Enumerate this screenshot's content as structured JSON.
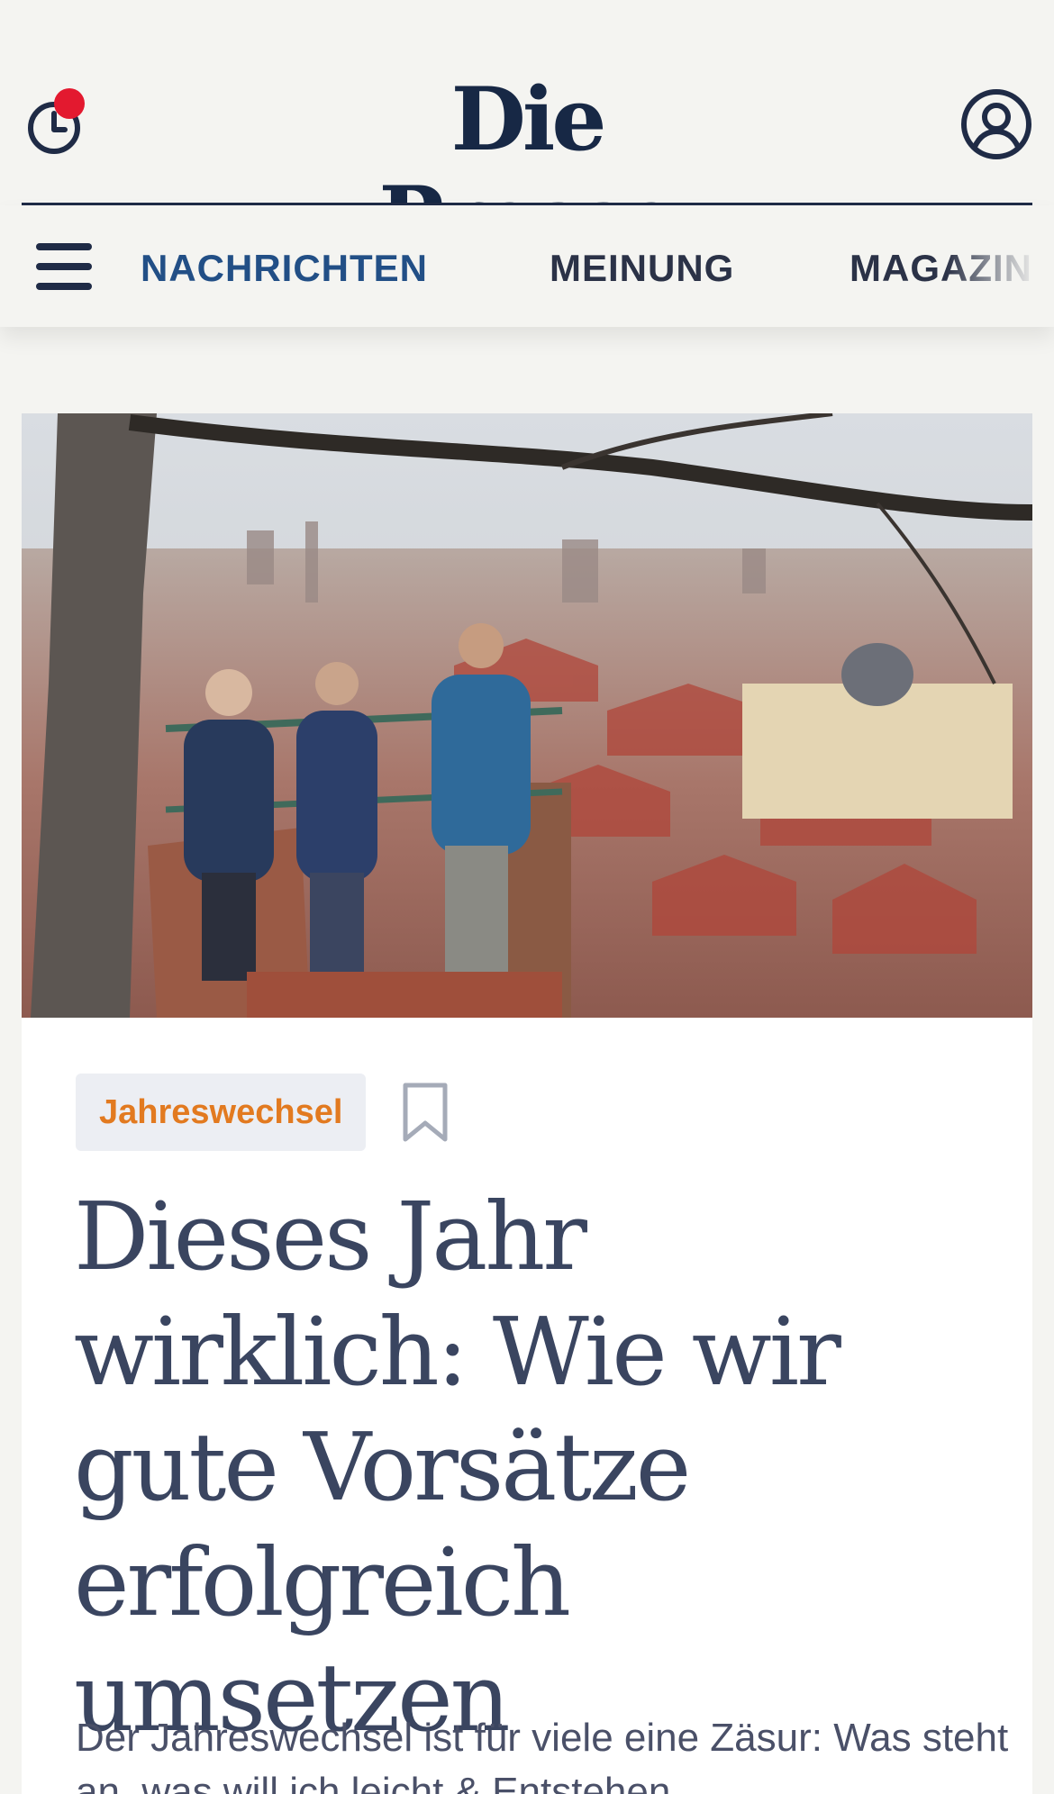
{
  "header": {
    "logo": "Die Presse",
    "history_icon": "clock-history-icon",
    "account_icon": "user-account-icon",
    "notification_color": "#e3192f"
  },
  "nav": {
    "menu_icon": "hamburger-menu-icon",
    "items": [
      {
        "label": "NACHRICHTEN",
        "active": true
      },
      {
        "label": "MEINUNG",
        "active": false
      },
      {
        "label": "MAGAZIN",
        "active": false
      }
    ]
  },
  "article": {
    "image_alt": "Drei Personen stehen an einem Geländer über den Dächern der Stadt",
    "kicker": "Jahreswechsel",
    "bookmark_icon": "bookmark-icon",
    "headline_lines": [
      "Dieses Jahr",
      "wirklich: Wie wir",
      "gute Vorsätze",
      "erfolgreich umsetzen"
    ],
    "lead": "Der Jahreswechsel ist für viele eine Zäsur: Was steht an, was will ich leicht & Entstehen"
  },
  "colors": {
    "brand": "#172845",
    "nav_active": "#224f86",
    "kicker_text": "#e27a20",
    "kicker_bg": "#eceef3",
    "headline": "#3a4560"
  }
}
